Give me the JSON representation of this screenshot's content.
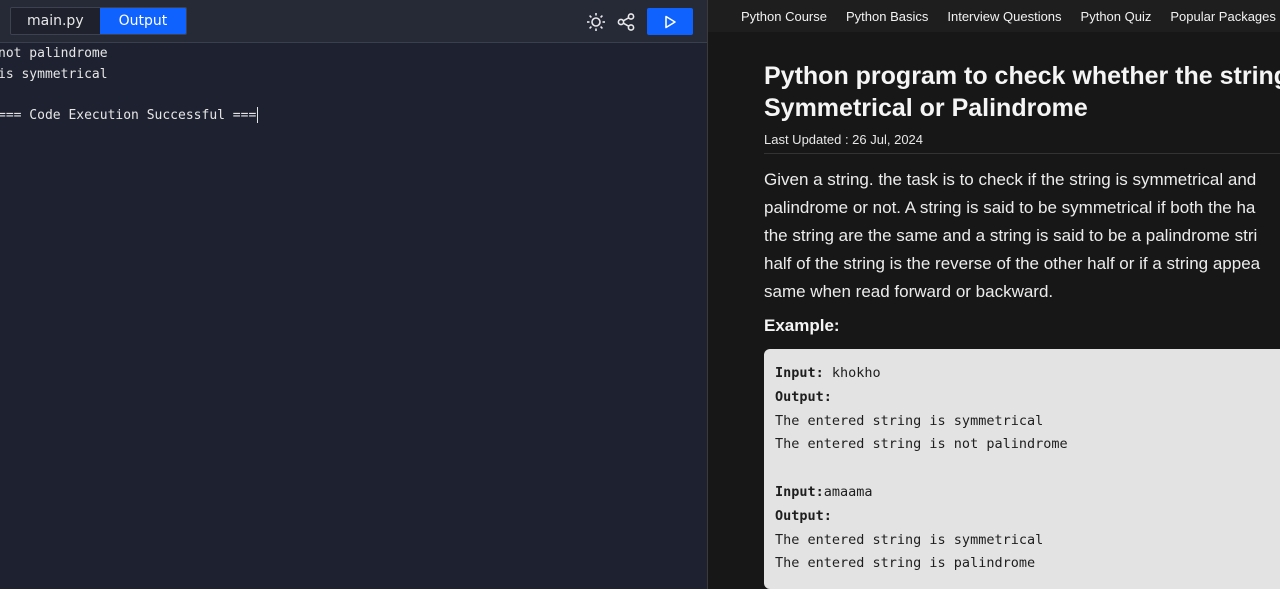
{
  "editor": {
    "tabs": [
      {
        "label": "main.py"
      },
      {
        "label": "Output"
      }
    ],
    "icons": {
      "theme": "sun-icon",
      "share": "share-icon",
      "run": "play-icon"
    },
    "colors": {
      "accent": "#0f62fe",
      "background": "#1e2230"
    },
    "output_lines": [
      "not palindrome",
      "is symmetrical",
      "",
      "=== Code Execution Successful ==="
    ]
  },
  "nav": {
    "links": [
      "Python Course",
      "Python Basics",
      "Interview Questions",
      "Python Quiz",
      "Popular Packages"
    ]
  },
  "article": {
    "title_line1": "Python program to check whether the string is",
    "title_line2": "Symmetrical or Palindrome",
    "updated": "Last Updated : 26 Jul, 2024",
    "paragraph_lines": [
      "Given a string. the task is to check if the string is symmetrical and",
      "palindrome or not. A string is said to be symmetrical if both the ha",
      "the string are the same and a string is said to be a palindrome stri",
      "half of the string is the reverse of the other half or if a string appea",
      "same when read forward or backward."
    ],
    "example_heading": "Example:",
    "example": {
      "input1_label": "Input:",
      "input1_value": " khokho",
      "output1_label": "Output:",
      "output1_lines": [
        "The entered string is symmetrical",
        "The entered string is not palindrome"
      ],
      "input2_label": "Input:",
      "input2_value": "amaama",
      "output2_label": "Output:",
      "output2_lines": [
        "The entered string is symmetrical",
        "The entered string is palindrome"
      ]
    }
  }
}
